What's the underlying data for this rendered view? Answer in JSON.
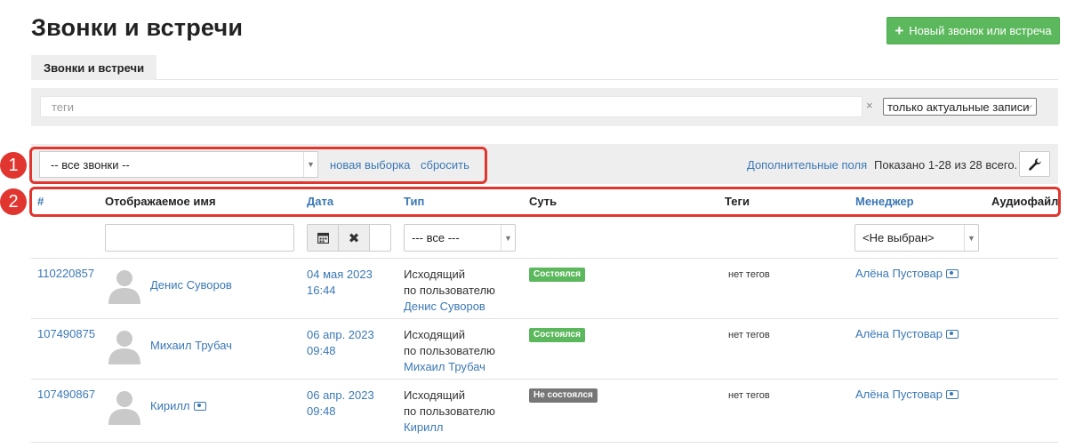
{
  "page": {
    "title": "Звонки и встречи",
    "new_button_label": "Новый звонок или встреча"
  },
  "tabs": [
    {
      "label": "Звонки и встречи",
      "active": true
    }
  ],
  "filter": {
    "tags_placeholder": "теги",
    "clear_symbol": "×",
    "actual_select": "только актуальные записи"
  },
  "toolbar": {
    "calls_select": "-- все звонки --",
    "new_selection": "новая выборка",
    "reset": "сбросить",
    "extra_fields": "Дополнительные поля",
    "shown": "Показано 1-28 из 28 всего."
  },
  "callouts": [
    "1",
    "2"
  ],
  "table": {
    "columns": {
      "id": "#",
      "name": "Отображаемое имя",
      "date": "Дата",
      "type": "Тип",
      "essence": "Суть",
      "tags": "Теги",
      "manager": "Менеджер",
      "audio": "Аудиофайл"
    },
    "filters": {
      "type_select": "--- все ---",
      "manager_select": "<Не выбран>"
    },
    "rows": [
      {
        "id": "110220857",
        "name": "Денис Суворов",
        "date": "04 мая 2023",
        "time": "16:44",
        "type_line1": "Исходящий",
        "type_line2": "по пользователю",
        "type_user": "Денис Суворов",
        "status": "Состоялся",
        "tags": "нет тегов",
        "manager": "Алёна Пустовар"
      },
      {
        "id": "107490875",
        "name": "Михаил Трубач",
        "date": "06 апр. 2023",
        "time": "09:48",
        "type_line1": "Исходящий",
        "type_line2": "по пользователю",
        "type_user": "Михаил Трубач",
        "status": "Состоялся",
        "tags": "нет тегов",
        "manager": "Алёна Пустовар"
      },
      {
        "id": "107490867",
        "name": "Кирилл",
        "date": "06 апр. 2023",
        "time": "09:48",
        "type_line1": "Исходящий",
        "type_line2": "по пользователю",
        "type_user": "Кирилл",
        "status": "Не состоялся",
        "tags": "нет тегов",
        "manager": "Алёна Пустовар"
      }
    ]
  },
  "colors": {
    "accent_link": "#3a78b5",
    "primary_button": "#5cb85c",
    "callout": "#e0362f",
    "status_ok": "#5cb85c",
    "status_failed": "#777777"
  }
}
